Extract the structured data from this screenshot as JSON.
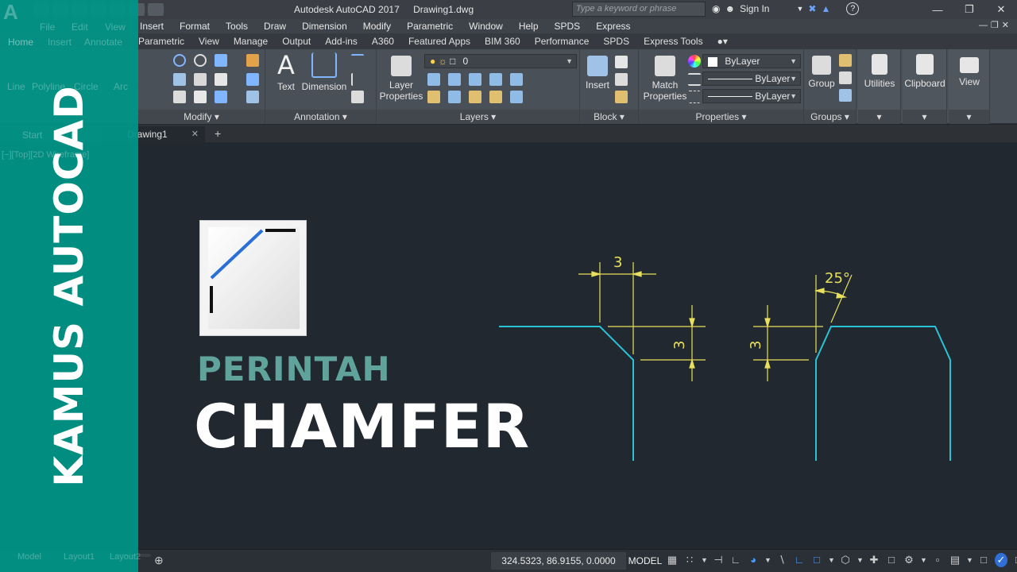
{
  "app": {
    "title": "Autodesk AutoCAD 2017",
    "document": "Drawing1.dwg",
    "search_placeholder": "Type a keyword or phrase",
    "sign_in": "Sign In"
  },
  "menubar": [
    "Insert",
    "Format",
    "Tools",
    "Draw",
    "Dimension",
    "Modify",
    "Parametric",
    "Window",
    "Help",
    "SPDS",
    "Express"
  ],
  "ribbon_tabs": [
    "Parametric",
    "View",
    "Manage",
    "Output",
    "Add-ins",
    "A360",
    "Featured Apps",
    "BIM 360",
    "Performance",
    "SPDS",
    "Express Tools"
  ],
  "ghost": {
    "menu": [
      "File",
      "Edit",
      "View"
    ],
    "tabs": [
      "Home",
      "Insert",
      "Annotate"
    ],
    "draw_tools": [
      "Line",
      "Polyline",
      "Circle",
      "Arc"
    ],
    "file_tabs": [
      "Start"
    ],
    "view_label": "[−][Top][2D Wireframe]",
    "layout_tabs": [
      "Model",
      "Layout1",
      "Layout2"
    ]
  },
  "ribbon": {
    "panels": {
      "modify": "Modify",
      "annotation": "Annotation",
      "layers": "Layers",
      "block": "Block",
      "properties": "Properties",
      "groups": "Groups"
    },
    "buttons": {
      "text": "Text",
      "dimension": "Dimension",
      "layer_props_1": "Layer",
      "layer_props_2": "Properties",
      "insert": "Insert",
      "match_props_1": "Match",
      "match_props_2": "Properties",
      "group": "Group",
      "utilities": "Utilities",
      "clipboard": "Clipboard",
      "view": "View"
    },
    "layer_value": "0",
    "color_value": "ByLayer",
    "linetype_value": "ByLayer",
    "lineweight_value": "ByLayer"
  },
  "file_tabs": {
    "drawing": "Drawing1"
  },
  "overlay": {
    "side_title": "KAMUS AUTOCAD",
    "perintah": "PERINTAH",
    "command": "CHAMFER"
  },
  "drawing": {
    "dim_top": "3",
    "dim_left_side": "3",
    "dim_right_side": "3",
    "angle": "25°",
    "line_color": "#29c3d6",
    "dim_color": "#e8e05a"
  },
  "statusbar": {
    "coords": "324.5323, 86.9155, 0.0000",
    "space": "MODEL"
  },
  "colors": {
    "teal": "#009688",
    "perintah": "#5fa39b",
    "canvas": "#212830"
  }
}
